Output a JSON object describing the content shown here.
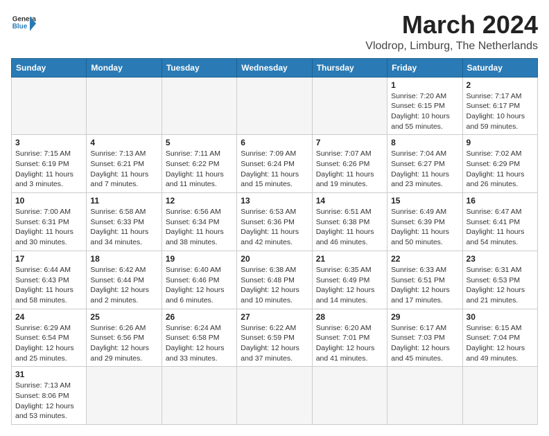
{
  "header": {
    "logo_general": "General",
    "logo_blue": "Blue",
    "month": "March 2024",
    "location": "Vlodrop, Limburg, The Netherlands"
  },
  "weekdays": [
    "Sunday",
    "Monday",
    "Tuesday",
    "Wednesday",
    "Thursday",
    "Friday",
    "Saturday"
  ],
  "weeks": [
    [
      {
        "day": "",
        "info": ""
      },
      {
        "day": "",
        "info": ""
      },
      {
        "day": "",
        "info": ""
      },
      {
        "day": "",
        "info": ""
      },
      {
        "day": "",
        "info": ""
      },
      {
        "day": "1",
        "info": "Sunrise: 7:20 AM\nSunset: 6:15 PM\nDaylight: 10 hours\nand 55 minutes."
      },
      {
        "day": "2",
        "info": "Sunrise: 7:17 AM\nSunset: 6:17 PM\nDaylight: 10 hours\nand 59 minutes."
      }
    ],
    [
      {
        "day": "3",
        "info": "Sunrise: 7:15 AM\nSunset: 6:19 PM\nDaylight: 11 hours\nand 3 minutes."
      },
      {
        "day": "4",
        "info": "Sunrise: 7:13 AM\nSunset: 6:21 PM\nDaylight: 11 hours\nand 7 minutes."
      },
      {
        "day": "5",
        "info": "Sunrise: 7:11 AM\nSunset: 6:22 PM\nDaylight: 11 hours\nand 11 minutes."
      },
      {
        "day": "6",
        "info": "Sunrise: 7:09 AM\nSunset: 6:24 PM\nDaylight: 11 hours\nand 15 minutes."
      },
      {
        "day": "7",
        "info": "Sunrise: 7:07 AM\nSunset: 6:26 PM\nDaylight: 11 hours\nand 19 minutes."
      },
      {
        "day": "8",
        "info": "Sunrise: 7:04 AM\nSunset: 6:27 PM\nDaylight: 11 hours\nand 23 minutes."
      },
      {
        "day": "9",
        "info": "Sunrise: 7:02 AM\nSunset: 6:29 PM\nDaylight: 11 hours\nand 26 minutes."
      }
    ],
    [
      {
        "day": "10",
        "info": "Sunrise: 7:00 AM\nSunset: 6:31 PM\nDaylight: 11 hours\nand 30 minutes."
      },
      {
        "day": "11",
        "info": "Sunrise: 6:58 AM\nSunset: 6:33 PM\nDaylight: 11 hours\nand 34 minutes."
      },
      {
        "day": "12",
        "info": "Sunrise: 6:56 AM\nSunset: 6:34 PM\nDaylight: 11 hours\nand 38 minutes."
      },
      {
        "day": "13",
        "info": "Sunrise: 6:53 AM\nSunset: 6:36 PM\nDaylight: 11 hours\nand 42 minutes."
      },
      {
        "day": "14",
        "info": "Sunrise: 6:51 AM\nSunset: 6:38 PM\nDaylight: 11 hours\nand 46 minutes."
      },
      {
        "day": "15",
        "info": "Sunrise: 6:49 AM\nSunset: 6:39 PM\nDaylight: 11 hours\nand 50 minutes."
      },
      {
        "day": "16",
        "info": "Sunrise: 6:47 AM\nSunset: 6:41 PM\nDaylight: 11 hours\nand 54 minutes."
      }
    ],
    [
      {
        "day": "17",
        "info": "Sunrise: 6:44 AM\nSunset: 6:43 PM\nDaylight: 11 hours\nand 58 minutes."
      },
      {
        "day": "18",
        "info": "Sunrise: 6:42 AM\nSunset: 6:44 PM\nDaylight: 12 hours\nand 2 minutes."
      },
      {
        "day": "19",
        "info": "Sunrise: 6:40 AM\nSunset: 6:46 PM\nDaylight: 12 hours\nand 6 minutes."
      },
      {
        "day": "20",
        "info": "Sunrise: 6:38 AM\nSunset: 6:48 PM\nDaylight: 12 hours\nand 10 minutes."
      },
      {
        "day": "21",
        "info": "Sunrise: 6:35 AM\nSunset: 6:49 PM\nDaylight: 12 hours\nand 14 minutes."
      },
      {
        "day": "22",
        "info": "Sunrise: 6:33 AM\nSunset: 6:51 PM\nDaylight: 12 hours\nand 17 minutes."
      },
      {
        "day": "23",
        "info": "Sunrise: 6:31 AM\nSunset: 6:53 PM\nDaylight: 12 hours\nand 21 minutes."
      }
    ],
    [
      {
        "day": "24",
        "info": "Sunrise: 6:29 AM\nSunset: 6:54 PM\nDaylight: 12 hours\nand 25 minutes."
      },
      {
        "day": "25",
        "info": "Sunrise: 6:26 AM\nSunset: 6:56 PM\nDaylight: 12 hours\nand 29 minutes."
      },
      {
        "day": "26",
        "info": "Sunrise: 6:24 AM\nSunset: 6:58 PM\nDaylight: 12 hours\nand 33 minutes."
      },
      {
        "day": "27",
        "info": "Sunrise: 6:22 AM\nSunset: 6:59 PM\nDaylight: 12 hours\nand 37 minutes."
      },
      {
        "day": "28",
        "info": "Sunrise: 6:20 AM\nSunset: 7:01 PM\nDaylight: 12 hours\nand 41 minutes."
      },
      {
        "day": "29",
        "info": "Sunrise: 6:17 AM\nSunset: 7:03 PM\nDaylight: 12 hours\nand 45 minutes."
      },
      {
        "day": "30",
        "info": "Sunrise: 6:15 AM\nSunset: 7:04 PM\nDaylight: 12 hours\nand 49 minutes."
      }
    ],
    [
      {
        "day": "31",
        "info": "Sunrise: 7:13 AM\nSunset: 8:06 PM\nDaylight: 12 hours\nand 53 minutes."
      },
      {
        "day": "",
        "info": ""
      },
      {
        "day": "",
        "info": ""
      },
      {
        "day": "",
        "info": ""
      },
      {
        "day": "",
        "info": ""
      },
      {
        "day": "",
        "info": ""
      },
      {
        "day": "",
        "info": ""
      }
    ]
  ]
}
